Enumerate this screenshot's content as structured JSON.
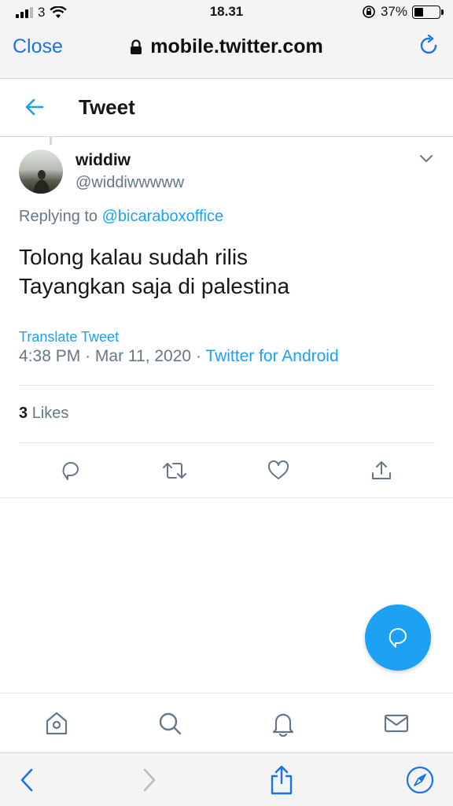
{
  "status_bar": {
    "carrier": "3",
    "time": "18.31",
    "battery_pct": "37%",
    "battery_level": 0.37
  },
  "browser": {
    "close_label": "Close",
    "url": "mobile.twitter.com"
  },
  "header": {
    "title": "Tweet"
  },
  "tweet": {
    "author_name": "widdiw",
    "author_handle": "@widdiwwwww",
    "replying_prefix": "Replying to",
    "replying_to": "@bicaraboxoffice",
    "text_line1": "Tolong kalau sudah rilis",
    "text_line2": "Tayangkan saja di palestina",
    "translate_label": "Translate Tweet",
    "time": "4:38 PM",
    "date": "Mar 11, 2020",
    "separator": "·",
    "source": "Twitter for Android",
    "likes_count": "3",
    "likes_label": "Likes"
  },
  "colors": {
    "accent": "#1da1f2",
    "safari_blue": "#1a73e8",
    "secondary_text": "#657786"
  },
  "icons": {
    "actions": [
      "reply-icon",
      "retweet-icon",
      "like-icon",
      "share-icon"
    ],
    "nav": [
      "home-icon",
      "search-icon",
      "notifications-icon",
      "messages-icon"
    ],
    "toolbar": [
      "back-icon",
      "forward-icon",
      "share-icon",
      "compass-icon"
    ]
  }
}
